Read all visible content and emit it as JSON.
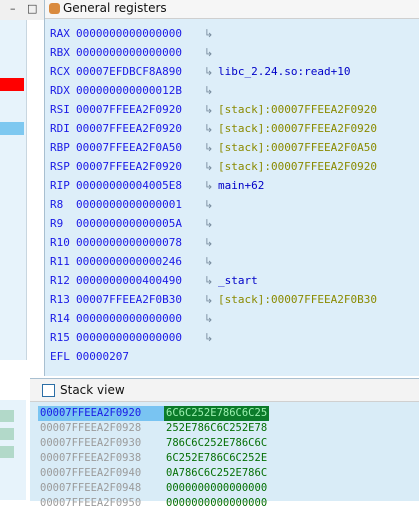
{
  "colors": {
    "register_value": "#1a1ae6",
    "stack_comment": "#8a8a00",
    "selected_stack_bg": "#79c4f2",
    "value_bg": "#0b7b2a",
    "red_marker": "#ff0000"
  },
  "left_controls": {
    "minimize": "–",
    "restore": "□"
  },
  "registers_panel": {
    "title": "General registers",
    "icon": "bug-icon",
    "rows": [
      {
        "name": "RAX",
        "value": "0000000000000000",
        "comment": ""
      },
      {
        "name": "RBX",
        "value": "0000000000000000",
        "comment": ""
      },
      {
        "name": "RCX",
        "value": "00007EFDBCF8A890",
        "comment": "libc_2.24.so:read+10"
      },
      {
        "name": "RDX",
        "value": "000000000000012B",
        "comment": ""
      },
      {
        "name": "RSI",
        "value": "00007FFEEA2F0920",
        "comment": "[stack]:00007FFEEA2F0920"
      },
      {
        "name": "RDI",
        "value": "00007FFEEA2F0920",
        "comment": "[stack]:00007FFEEA2F0920"
      },
      {
        "name": "RBP",
        "value": "00007FFEEA2F0A50",
        "comment": "[stack]:00007FFEEA2F0A50"
      },
      {
        "name": "RSP",
        "value": "00007FFEEA2F0920",
        "comment": "[stack]:00007FFEEA2F0920"
      },
      {
        "name": "RIP",
        "value": "00000000004005E8",
        "comment": "main+62"
      },
      {
        "name": "R8",
        "value": "0000000000000001",
        "comment": ""
      },
      {
        "name": "R9",
        "value": "000000000000005A",
        "comment": ""
      },
      {
        "name": "R10",
        "value": "0000000000000078",
        "comment": ""
      },
      {
        "name": "R11",
        "value": "0000000000000246",
        "comment": ""
      },
      {
        "name": "R12",
        "value": "0000000000400490",
        "comment": "_start"
      },
      {
        "name": "R13",
        "value": "00007FFEEA2F0B30",
        "comment": "[stack]:00007FFEEA2F0B30"
      },
      {
        "name": "R14",
        "value": "0000000000000000",
        "comment": ""
      },
      {
        "name": "R15",
        "value": "0000000000000000",
        "comment": ""
      },
      {
        "name": "EFL",
        "value": "00000207",
        "comment": ""
      }
    ]
  },
  "stack_panel": {
    "title": "Stack view",
    "rows": [
      {
        "addr": "00007FFEEA2F0920",
        "value": "6C6C252E786C6C25",
        "selected": true
      },
      {
        "addr": "00007FFEEA2F0928",
        "value": "252E786C6C252E78",
        "selected": false
      },
      {
        "addr": "00007FFEEA2F0930",
        "value": "786C6C252E786C6C",
        "selected": false
      },
      {
        "addr": "00007FFEEA2F0938",
        "value": "6C252E786C6C252E",
        "selected": false
      },
      {
        "addr": "00007FFEEA2F0940",
        "value": "0A786C6C252E786C",
        "selected": false
      },
      {
        "addr": "00007FFEEA2F0948",
        "value": "0000000000000000",
        "selected": false
      },
      {
        "addr": "00007FFEEA2F0950",
        "value": "0000000000000000",
        "selected": false
      }
    ]
  }
}
